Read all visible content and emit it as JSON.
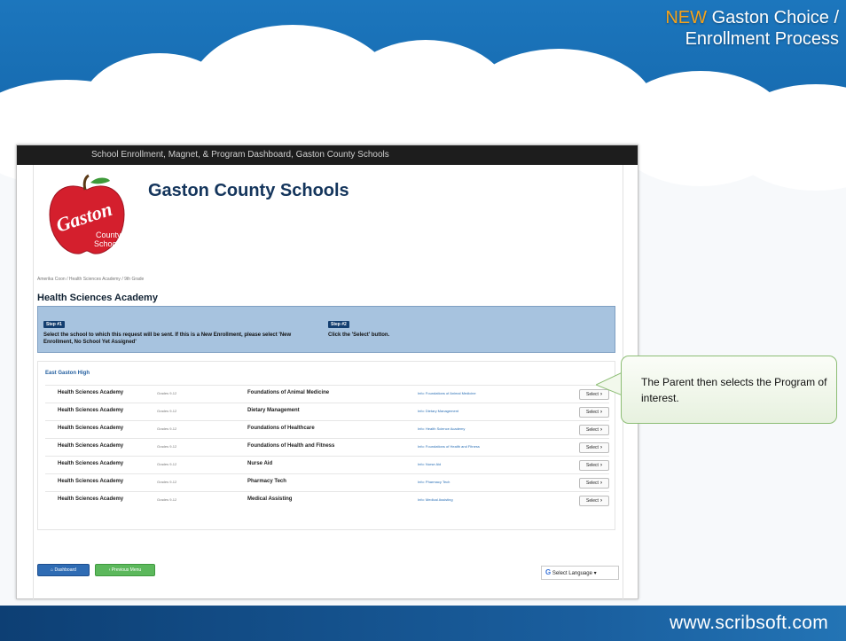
{
  "slide": {
    "title_new": "NEW",
    "title_rest": " Gaston Choice /",
    "title_line2": "Enrollment Process",
    "footer_url": "www.scribsoft.com"
  },
  "browser": {
    "top_bar": "School Enrollment, Magnet, & Program Dashboard, Gaston County Schools"
  },
  "page": {
    "logo_text": "Gaston",
    "logo_sub1": "County",
    "logo_sub2": "Schools",
    "school_title": "Gaston County Schools",
    "breadcrumb": "Amerika Coon / Health Sciences Academy / 9th Grade",
    "academy_heading": "Health Sciences Academy",
    "step1_tag": "Step #1",
    "step1_text": "Select the school to which this request will be sent. If this is a New Enrollment, please select 'New Enrollment, No School Yet Assigned'",
    "step2_tag": "Step #2",
    "step2_text": "Click the 'Select' button.",
    "school_group": "East Gaston High",
    "rows": [
      {
        "school": "Health Sciences Academy",
        "grades": "Grades 9-12",
        "program": "Foundations of Animal Medicine",
        "info": "Info: Foundations of Animal Medicine",
        "action": "Select"
      },
      {
        "school": "Health Sciences Academy",
        "grades": "Grades 9-12",
        "program": "Dietary Management",
        "info": "Info: Dietary Management",
        "action": "Select"
      },
      {
        "school": "Health Sciences Academy",
        "grades": "Grades 9-12",
        "program": "Foundations of Healthcare",
        "info": "Info: Health Science Academy",
        "action": "Select"
      },
      {
        "school": "Health Sciences Academy",
        "grades": "Grades 9-12",
        "program": "Foundations of Health and Fitness",
        "info": "Info: Foundations of Health and Fitness",
        "action": "Select"
      },
      {
        "school": "Health Sciences Academy",
        "grades": "Grades 9-12",
        "program": "Nurse Aid",
        "info": "Info: Nurse Aid",
        "action": "Select"
      },
      {
        "school": "Health Sciences Academy",
        "grades": "Grades 9-12",
        "program": "Pharmacy Tech",
        "info": "Info: Pharmacy Tech",
        "action": "Select"
      },
      {
        "school": "Health Sciences Academy",
        "grades": "Grades 9-12",
        "program": "Medical Assisting",
        "info": "Info: Medical Assisting",
        "action": "Select"
      }
    ],
    "dashboard_btn": "Dashboard",
    "prev_btn": "Previous Menu",
    "language": "Select Language"
  },
  "callout": {
    "text": "The Parent then selects the Program of interest."
  },
  "colors": {
    "sky": "#1c76bd",
    "title_new": "#f3a21c",
    "steps_bg": "#a7c3df",
    "callout_border": "#8cbd74",
    "apple": "#d41f2d"
  },
  "icons": {
    "select_arrow": "chevron-right-icon",
    "dashboard": "home-icon",
    "previous": "chevron-left-icon",
    "language": "google-g-icon"
  }
}
